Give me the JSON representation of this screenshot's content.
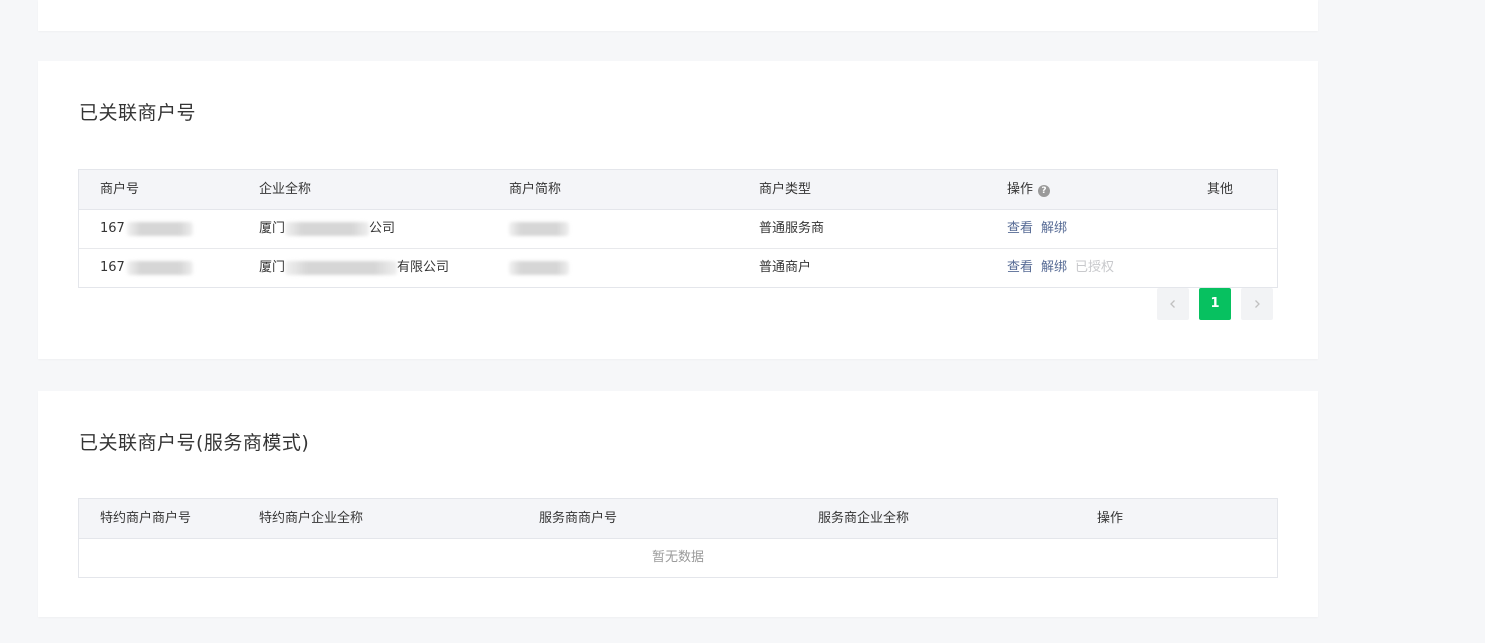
{
  "section1": {
    "title": "已关联商户号",
    "columns": [
      "商户号",
      "企业全称",
      "商户简称",
      "商户类型",
      "操作",
      "其他"
    ],
    "help_icon": "question-circle-icon",
    "rows": [
      {
        "merchant_id": "167",
        "company_prefix": "厦门",
        "company_suffix": "公司",
        "merchant_type": "普通服务商",
        "actions": [
          "查看",
          "解绑"
        ]
      },
      {
        "merchant_id": "167",
        "company_prefix": "厦门",
        "company_suffix": "有限公司",
        "merchant_type": "普通商户",
        "actions": [
          "查看",
          "解绑"
        ],
        "disabled_action": "已授权"
      }
    ],
    "pagination": {
      "prev_icon": "chevron-left-icon",
      "current_page": "1",
      "next_icon": "chevron-right-icon"
    }
  },
  "section2": {
    "title": "已关联商户号(服务商模式)",
    "columns": [
      "特约商户商户号",
      "特约商户企业全称",
      "服务商商户号",
      "服务商企业全称",
      "操作"
    ],
    "empty_text": "暂无数据"
  },
  "colors": {
    "link": "#576b95",
    "primary": "#07c160",
    "background": "#f6f7f9"
  }
}
